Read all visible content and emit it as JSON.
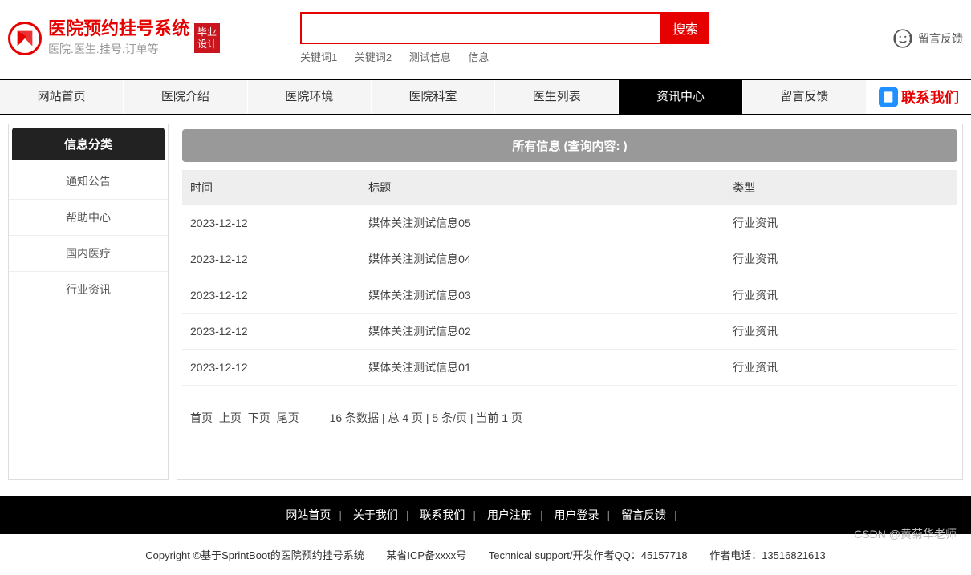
{
  "header": {
    "title": "医院预约挂号系统",
    "subtitle": "医院.医生.挂号.订单等",
    "badge_line1": "毕业",
    "badge_line2": "设计",
    "search_btn": "搜索",
    "keywords": [
      "关键词1",
      "关键词2",
      "测试信息",
      "信息"
    ],
    "feedback": "留言反馈"
  },
  "nav": {
    "items": [
      "网站首页",
      "医院介绍",
      "医院环境",
      "医院科室",
      "医生列表",
      "资讯中心",
      "留言反馈"
    ],
    "active_index": 5,
    "contact": "联系我们"
  },
  "sidebar": {
    "header": "信息分类",
    "items": [
      "通知公告",
      "帮助中心",
      "国内医疗",
      "行业资讯"
    ]
  },
  "content": {
    "header": "所有信息 (查询内容: )",
    "columns": [
      "时间",
      "标题",
      "类型"
    ],
    "rows": [
      {
        "time": "2023-12-12",
        "title": "媒体关注测试信息05",
        "type": "行业资讯"
      },
      {
        "time": "2023-12-12",
        "title": "媒体关注测试信息04",
        "type": "行业资讯"
      },
      {
        "time": "2023-12-12",
        "title": "媒体关注测试信息03",
        "type": "行业资讯"
      },
      {
        "time": "2023-12-12",
        "title": "媒体关注测试信息02",
        "type": "行业资讯"
      },
      {
        "time": "2023-12-12",
        "title": "媒体关注测试信息01",
        "type": "行业资讯"
      }
    ]
  },
  "pagination": {
    "first": "首页",
    "prev": "上页",
    "next": "下页",
    "last": "尾页",
    "info": "16 条数据 | 总 4 页 | 5 条/页 | 当前 1 页"
  },
  "footer": {
    "nav": [
      "网站首页",
      "关于我们",
      "联系我们",
      "用户注册",
      "用户登录",
      "留言反馈"
    ],
    "copyright": "Copyright ©基于SprintBoot的医院预约挂号系统",
    "icp": "某省ICP备xxxx号",
    "support": "Technical support/开发作者QQ：45157718",
    "phone": "作者电话：13516821613"
  },
  "watermark": "CSDN @黄菊华老师"
}
